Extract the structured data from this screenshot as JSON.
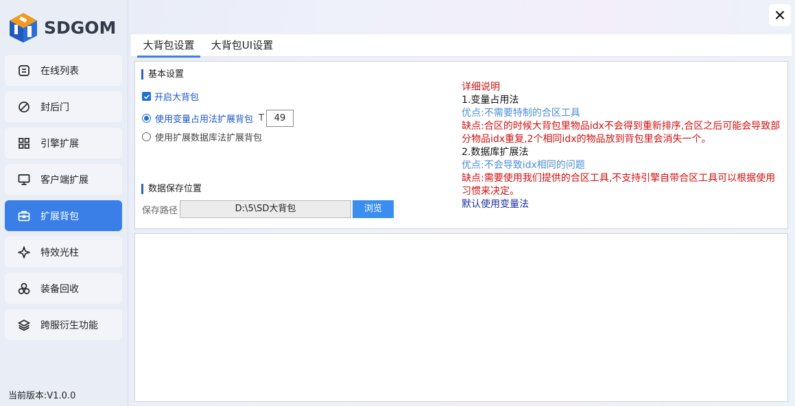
{
  "brand": {
    "name": "SDGOM"
  },
  "sidebar": {
    "items": [
      {
        "label": "在线列表",
        "icon": "list-icon",
        "active": false
      },
      {
        "label": "封后门",
        "icon": "ban-icon",
        "active": false
      },
      {
        "label": "引擎扩展",
        "icon": "grid-icon",
        "active": false
      },
      {
        "label": "客户端扩展",
        "icon": "monitor-icon",
        "active": false
      },
      {
        "label": "扩展背包",
        "icon": "briefcase-icon",
        "active": true
      },
      {
        "label": "特效光柱",
        "icon": "sparkle-icon",
        "active": false
      },
      {
        "label": "装备回收",
        "icon": "recycle-icon",
        "active": false
      },
      {
        "label": "跨服衍生功能",
        "icon": "layers-icon",
        "active": false
      }
    ],
    "version": "当前版本:V1.0.0"
  },
  "tabs": [
    {
      "label": "大背包设置",
      "active": true
    },
    {
      "label": "大背包UI设置",
      "active": false
    }
  ],
  "basic": {
    "title": "基本设置",
    "enable_label": "开启大背包",
    "enable_checked": true,
    "radio1_label": "使用变量占用法扩展背包",
    "radio1_selected": true,
    "t_label": "T",
    "t_value": "49",
    "radio2_label": "使用扩展数据库法扩展背包",
    "radio2_selected": false
  },
  "storage": {
    "title": "数据保存位置",
    "path_label": "保存路径",
    "path_value": "D:\\5\\SD大背包",
    "browse_label": "浏览"
  },
  "explain": {
    "heading": "详细说明",
    "m1_title": "1.变量占用法",
    "m1_pro": "优点:不需要特制的合区工具",
    "m1_con": "缺点:合区的时候大背包里物品idx不会得到重新排序,合区之后可能会导致部分物品idx重复,2个相同idx的物品放到背包里会消失一个。",
    "m2_title": "2.数据库扩展法",
    "m2_pro": "优点:不会导致idx相同的问题",
    "m2_con": "缺点:需要使用我们提供的合区工具,不支持引擎自带合区工具可以根据使用习惯来决定。",
    "default": "默认使用变量法"
  },
  "colors": {
    "accent": "#3a7ee8",
    "red": "#d01010",
    "light_blue": "#4a8fd8",
    "navy": "#1a2fa0"
  }
}
